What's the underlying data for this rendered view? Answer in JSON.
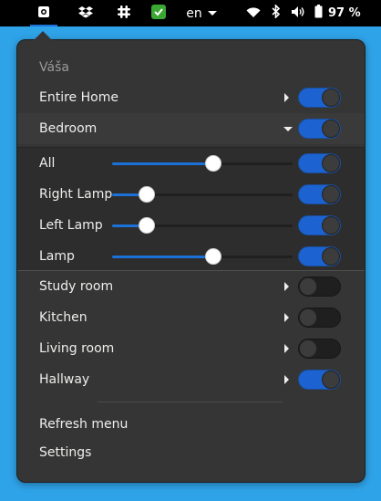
{
  "panel": {
    "language": "en",
    "battery_percent": "97 %",
    "icons": [
      "screenshot-indicator-icon",
      "dropbox-icon",
      "slack-icon",
      "shield-check-icon",
      "wifi-icon",
      "bluetooth-icon",
      "volume-icon",
      "battery-icon"
    ]
  },
  "menu": {
    "header": "Váša",
    "groups": [
      {
        "label": "Entire Home",
        "on": true,
        "expander": "collapsed"
      },
      {
        "label": "Bedroom",
        "on": true,
        "expander": "expanded"
      }
    ],
    "lights": [
      {
        "label": "All",
        "level": 0.56,
        "on": true
      },
      {
        "label": "Right Lamp",
        "level": 0.19,
        "on": true
      },
      {
        "label": "Left Lamp",
        "level": 0.19,
        "on": true
      },
      {
        "label": "Lamp",
        "level": 0.56,
        "on": true
      }
    ],
    "rooms": [
      {
        "label": "Study room",
        "on": false
      },
      {
        "label": "Kitchen",
        "on": false
      },
      {
        "label": "Living room",
        "on": false
      },
      {
        "label": "Hallway",
        "on": true
      }
    ],
    "actions": {
      "refresh": "Refresh menu",
      "settings": "Settings"
    }
  },
  "colors": {
    "background": "#2fa3e8",
    "accent": "#1c71d8",
    "popup": "#353535"
  }
}
